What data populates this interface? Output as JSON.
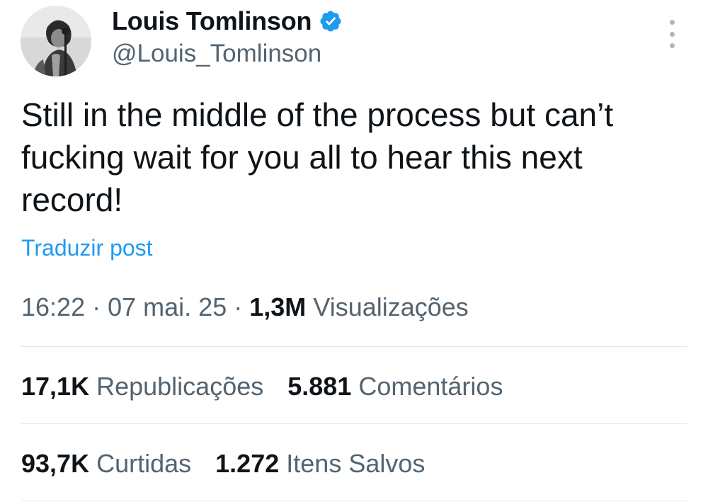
{
  "author": {
    "name": "Louis Tomlinson",
    "handle": "@Louis_Tomlinson",
    "verified": true
  },
  "tweet": {
    "text": "Still in the middle of the process but can’t\nfucking wait for you all to hear this next\nrecord!",
    "translate_label": "Traduzir post"
  },
  "meta": {
    "time": "16:22",
    "separator": "·",
    "date": "07 mai. 25",
    "views_count": "1,3M",
    "views_label": "Visualizações"
  },
  "stats_row1": {
    "reposts_count": "17,1K",
    "reposts_label": "Republicações",
    "comments_count": "5.881",
    "comments_label": "Comentários"
  },
  "stats_row2": {
    "likes_count": "93,7K",
    "likes_label": "Curtidas",
    "bookmarks_count": "1.272",
    "bookmarks_label": "Itens Salvos"
  },
  "colors": {
    "text": "#0f1419",
    "secondary": "#536471",
    "link": "#1d9bf0",
    "verified": "#1d9bf0",
    "divider": "#e1e6ea"
  },
  "icons": {
    "verified": "verified-badge-icon",
    "more": "more-vertical-icon"
  }
}
